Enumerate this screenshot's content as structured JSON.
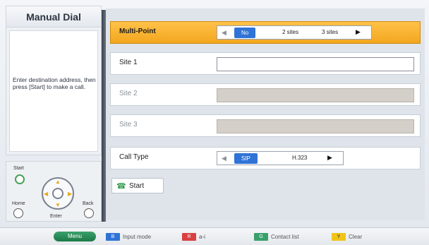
{
  "left_panel": {
    "title": "Manual Dial",
    "message": "Enter destination address, then press [Start] to make a call."
  },
  "remote": {
    "start_label": "Start",
    "home_label": "Home",
    "back_label": "Back",
    "enter_label": "Enter"
  },
  "form": {
    "multipoint": {
      "label": "Multi-Point",
      "options": [
        "No",
        "2 sites",
        "3 sites"
      ],
      "selected": "No"
    },
    "site1": {
      "label": "Site 1",
      "value": ""
    },
    "site2": {
      "label": "Site 2",
      "value": ""
    },
    "site3": {
      "label": "Site 3",
      "value": ""
    },
    "call_type": {
      "label": "Call Type",
      "options": [
        "SIP",
        "H.323"
      ],
      "selected": "SIP"
    },
    "start_button": "Start"
  },
  "bottom_bar": {
    "menu": "Menu",
    "b_key": "B",
    "b_label": "Input mode",
    "r_key": "R",
    "r_label": "a-i",
    "g_key": "G",
    "g_label": "Contact list",
    "y_key": "Y",
    "y_label": "Clear",
    "colors": {
      "blue": "#2f73d6",
      "red": "#d94040",
      "green": "#3aa06b",
      "yellow": "#f0c419"
    }
  }
}
